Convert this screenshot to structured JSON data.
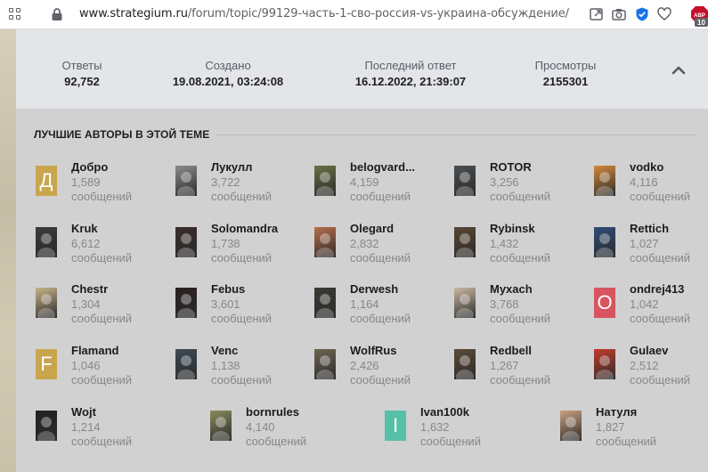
{
  "browser": {
    "url_domain": "www.strategium.ru",
    "url_path": "/forum/topic/99129-часть-1-сво-россия-vs-украина-обсуждение/",
    "ext_badge": "10",
    "ext_label": "ABP"
  },
  "stats": {
    "answers_label": "Ответы",
    "answers_value": "92,752",
    "created_label": "Создано",
    "created_value": "19.08.2021, 03:24:08",
    "last_label": "Последний ответ",
    "last_value": "16.12.2022, 21:39:07",
    "views_label": "Просмотры",
    "views_value": "2155301"
  },
  "authors": {
    "title": "ЛУЧШИЕ АВТОРЫ В ЭТОЙ ТЕМЕ",
    "unit": "сообщений",
    "list": [
      {
        "name": "Добро",
        "count": "1,589",
        "letter": "Д",
        "color": "#c9a64e"
      },
      {
        "name": "Лукулл",
        "count": "3,722",
        "color": "#8c8c8c"
      },
      {
        "name": "belogvard...",
        "count": "4,159",
        "color": "#6b7046"
      },
      {
        "name": "ROTOR",
        "count": "3,256",
        "color": "#4a4f52"
      },
      {
        "name": "vodko",
        "count": "4,116",
        "color": "#d4883a"
      },
      {
        "name": "Kruk",
        "count": "6,612",
        "color": "#3c3a3a"
      },
      {
        "name": "Solomandra",
        "count": "1,738",
        "color": "#3a2c2c"
      },
      {
        "name": "Olegard",
        "count": "2,832",
        "color": "#b86d4a"
      },
      {
        "name": "Rybinsk",
        "count": "1,432",
        "color": "#5a4632"
      },
      {
        "name": "Rettich",
        "count": "1,027",
        "color": "#2f4d78"
      },
      {
        "name": "Chestr",
        "count": "1,304",
        "color": "#c8b48a"
      },
      {
        "name": "Febus",
        "count": "3,601",
        "color": "#2a2020"
      },
      {
        "name": "Derwesh",
        "count": "1,164",
        "color": "#3a3a34"
      },
      {
        "name": "Myxach",
        "count": "3,768",
        "color": "#c9b9a3"
      },
      {
        "name": "ondrej413",
        "count": "1,042",
        "letter": "O",
        "color": "#d8545f"
      },
      {
        "name": "Flamand",
        "count": "1,046",
        "letter": "F",
        "color": "#c9a64e"
      },
      {
        "name": "Venc",
        "count": "1,138",
        "color": "#3d4a55"
      },
      {
        "name": "WolfRus",
        "count": "2,426",
        "color": "#6e6452"
      },
      {
        "name": "Redbell",
        "count": "1,267",
        "color": "#5c4a36"
      },
      {
        "name": "Gulaev",
        "count": "2,512",
        "color": "#c43a2a"
      },
      {
        "name": "Wojt",
        "count": "1,214",
        "color": "#222222"
      },
      {
        "name": "bornrules",
        "count": "4,140",
        "color": "#8a8a5e"
      },
      {
        "name": "Ivan100k",
        "count": "1,632",
        "letter": "I",
        "color": "#56c0a8"
      },
      {
        "name": "Натуля",
        "count": "1,827",
        "color": "#c9a080"
      }
    ]
  }
}
